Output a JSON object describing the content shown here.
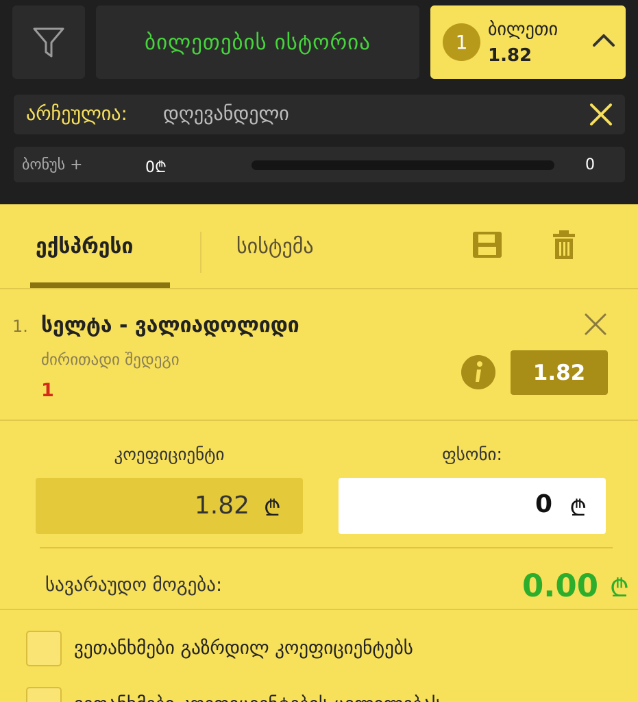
{
  "header": {
    "history_button": "ბილეთების ისტორია",
    "ticket": {
      "count": "1",
      "label": "ბილეთი",
      "odds": "1.82"
    }
  },
  "filter": {
    "selected_label": "არჩეულია:",
    "selected_value": "დღევანდელი"
  },
  "bonus": {
    "label": "ბონუს +",
    "amount": "0₾",
    "count": "0",
    "progress": 0
  },
  "tabs": {
    "express": "ექსპრესი",
    "system": "სისტემა"
  },
  "bet": {
    "index": "1.",
    "match": "სელტა - ვალიადოლიდი",
    "market": "ძირითადი შედეგი",
    "pick": "1",
    "odds": "1.82"
  },
  "stake": {
    "coef_label": "კოეფიციენტი",
    "coef_value": "1.82",
    "stake_label": "ფსონი:",
    "stake_value": "0",
    "currency": "₾"
  },
  "winnings": {
    "label": "სავარაუდო მოგება:",
    "value": "0.00",
    "currency": "₾"
  },
  "options": [
    {
      "label": "ვეთანხმები გაზრდილ კოეფიციენტებს"
    },
    {
      "label": "ვეთანხმები კოეფიციენტების ცვლილებას"
    }
  ],
  "icons": {
    "filter": "filter-funnel-icon",
    "chevron": "chevron-up-icon",
    "close": "close-icon",
    "save": "save-floppy-icon",
    "trash": "trash-icon",
    "info": "info-icon"
  },
  "colors": {
    "accent": "#f7e05a",
    "dark": "#1f1f1f",
    "green": "#46d43c",
    "pick_red": "#d42a1a",
    "odds_bg": "#a88d16"
  }
}
